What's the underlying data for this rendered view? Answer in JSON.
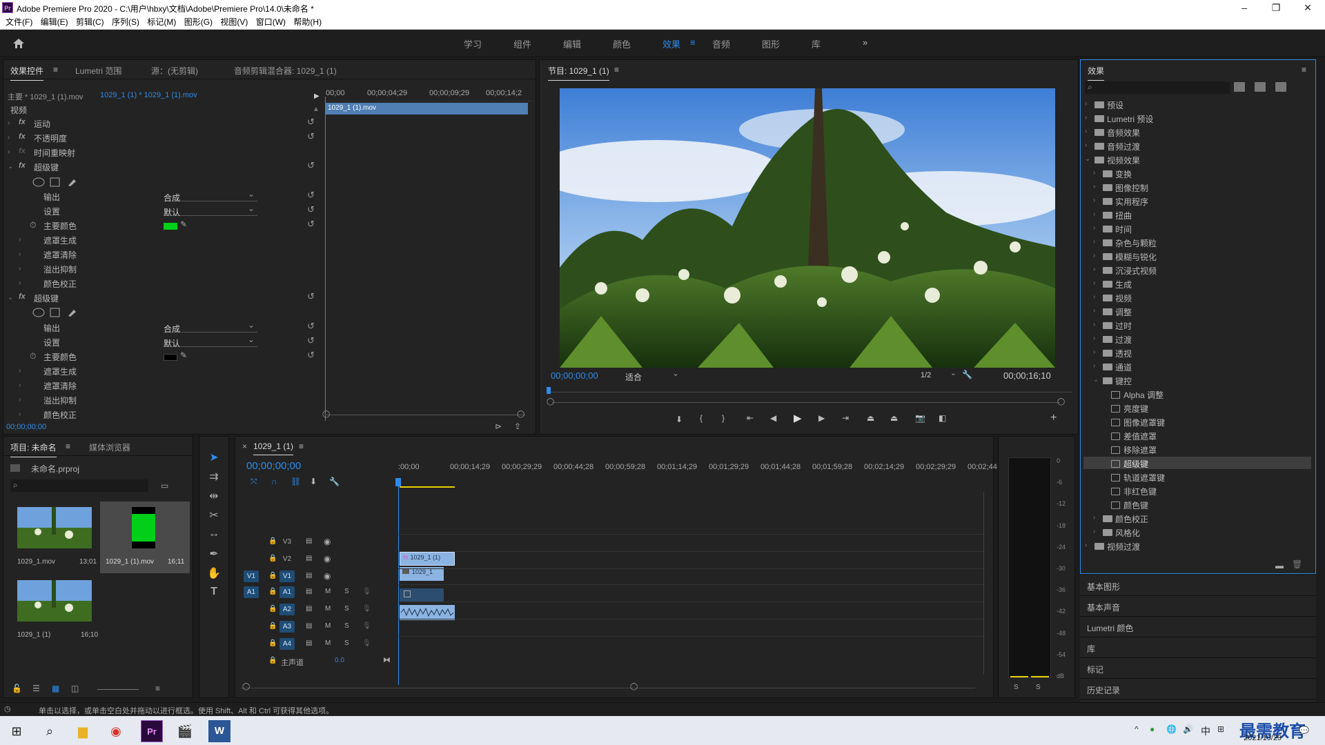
{
  "window": {
    "title": "Adobe Premiere Pro 2020 - C:\\用户\\hbxy\\文档\\Adobe\\Premiere Pro\\14.0\\未命名 *",
    "app_badge": "Pr"
  },
  "menu": [
    "文件(F)",
    "编辑(E)",
    "剪辑(C)",
    "序列(S)",
    "标记(M)",
    "图形(G)",
    "视图(V)",
    "窗口(W)",
    "帮助(H)"
  ],
  "workspaces": {
    "items": [
      "学习",
      "组件",
      "编辑",
      "颜色",
      "效果",
      "音频",
      "图形",
      "库"
    ],
    "active": "效果",
    "more": "»"
  },
  "effect_controls": {
    "tabs": [
      "效果控件",
      "Lumetri 范围",
      "源：(无剪辑)",
      "音频剪辑混合器: 1029_1 (1)"
    ],
    "master_label": "主要 * 1029_1 (1).mov",
    "clip_label": "1029_1 (1) * 1029_1 (1).mov",
    "ruler": [
      "00;00",
      "00;00;04;29",
      "00;00;09;29",
      "00;00;14;2"
    ],
    "clip_bar": "1029_1 (1).mov",
    "section": "视频",
    "rows": {
      "motion": "运动",
      "opacity": "不透明度",
      "time_remap": "时间重映射",
      "ultra_key_1": "超级键",
      "output": "输出",
      "output_value": "合成",
      "setting": "设置",
      "setting_value": "默认",
      "key_color": "主要颜色",
      "matte_gen": "遮罩生成",
      "matte_clean": "遮罩清除",
      "spill": "溢出抑制",
      "color_correct": "颜色校正",
      "ultra_key_2": "超级键"
    },
    "key_color_1": "#00d01a",
    "key_color_2": "#000000",
    "timecode": "00;00;00;00"
  },
  "program": {
    "title": "节目: 1029_1 (1)",
    "timecode": "00;00;00;00",
    "fit": "适合",
    "resolution": "1/2",
    "duration": "00;00;16;10"
  },
  "effects_panel": {
    "title": "效果",
    "top_items": [
      "预设",
      "Lumetri 预设",
      "音频效果",
      "音频过渡",
      "视频效果"
    ],
    "video_effects": [
      "变换",
      "图像控制",
      "实用程序",
      "扭曲",
      "时间",
      "杂色与颗粒",
      "模糊与锐化",
      "沉浸式视频",
      "生成",
      "视频",
      "调整",
      "过时",
      "过渡",
      "透视",
      "通道",
      "键控"
    ],
    "keying": [
      "Alpha 调整",
      "亮度键",
      "图像遮罩键",
      "差值遮罩",
      "移除遮罩",
      "超级键",
      "轨道遮罩键",
      "非红色键",
      "颜色键"
    ],
    "selected": "超级键",
    "after_keying": [
      "颜色校正",
      "风格化"
    ],
    "last": "视频过渡",
    "collapsed_panels": [
      "基本图形",
      "基本声音",
      "Lumetri 颜色",
      "库",
      "标记",
      "历史记录"
    ]
  },
  "project": {
    "tabs": [
      "项目: 未命名",
      "媒体浏览器"
    ],
    "file": "未命名.prproj",
    "items": [
      {
        "name": "1029_1.mov",
        "duration": "13;01"
      },
      {
        "name": "1029_1 (1).mov",
        "duration": "16;11"
      },
      {
        "name": "1029_1 (1)",
        "duration": "16;10"
      }
    ]
  },
  "timeline": {
    "tab": "1029_1 (1)",
    "timecode": "00;00;00;00",
    "ruler": [
      ":00;00",
      "00;00;14;29",
      "00;00;29;29",
      "00;00;44;28",
      "00;00;59;28",
      "00;01;14;29",
      "00;01;29;29",
      "00;01;44;28",
      "00;01;59;28",
      "00;02;14;29",
      "00;02;29;29",
      "00;02;44;"
    ],
    "video_tracks": [
      "V3",
      "V2",
      "V1"
    ],
    "audio_tracks": [
      "A1",
      "A2",
      "A3",
      "A4"
    ],
    "source_v": "V1",
    "source_a": "A1",
    "master": "主声道",
    "master_value": "0.0",
    "clip_v2": "1029_1 (1)",
    "clip_v1": "1029_1",
    "m": "M",
    "s": "S"
  },
  "meter": {
    "labels": [
      "0",
      "-6",
      "-12",
      "-18",
      "-24",
      "-30",
      "-36",
      "-42",
      "-48",
      "-54",
      "dB"
    ],
    "solo": [
      "S",
      "S"
    ]
  },
  "status": "单击以选择，或单击空白处并拖动以进行框选。使用 Shift、Alt 和 Ctrl 可获得其他选项。",
  "taskbar": {
    "ime": "中",
    "date": "2021/10/29",
    "watermark": "最需教育"
  }
}
